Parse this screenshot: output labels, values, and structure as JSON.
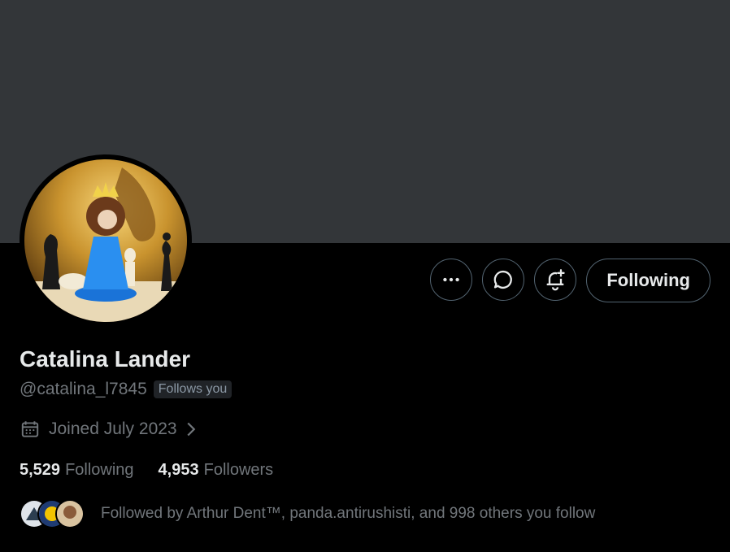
{
  "profile": {
    "name": "Catalina Lander",
    "handle": "@catalina_l7845",
    "follows_you_badge": "Follows you",
    "joined": "Joined July 2023",
    "following_count": "5,529",
    "following_label": "Following",
    "followers_count": "4,953",
    "followers_label": "Followers",
    "followed_by_text": "Followed by Arthur Dent™, panda.antirushisti, and 998 others you follow"
  },
  "actions": {
    "follow_button_label": "Following",
    "icons": [
      "more-icon",
      "message-icon",
      "notification-bell-icon"
    ]
  },
  "colors": {
    "banner": "#333639",
    "background": "#000000",
    "primary_text": "#e7e9ea",
    "secondary_text": "#71767b",
    "button_border": "#536471"
  }
}
